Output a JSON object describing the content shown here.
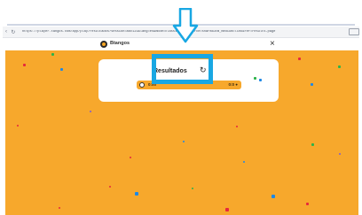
{
  "browser": {
    "url": "https://player.tangos.com/app/play/resultados?session=abc123&lang=es&mode=classic&utm_source=share&utm_medium=link&ref=results-page"
  },
  "header": {
    "brand": "Btangos",
    "close_glyph": "×"
  },
  "results_card": {
    "title": "Resultados",
    "refresh_glyph": "↻",
    "row": {
      "score": "0:00",
      "right": "0:0 ●"
    }
  },
  "colors": {
    "background": "#f7a82c",
    "highlight": "#18a7e3"
  },
  "icons": [
    "arrow-down-annotation-icon",
    "logo-icon",
    "close-icon",
    "refresh-icon",
    "clock-icon"
  ]
}
